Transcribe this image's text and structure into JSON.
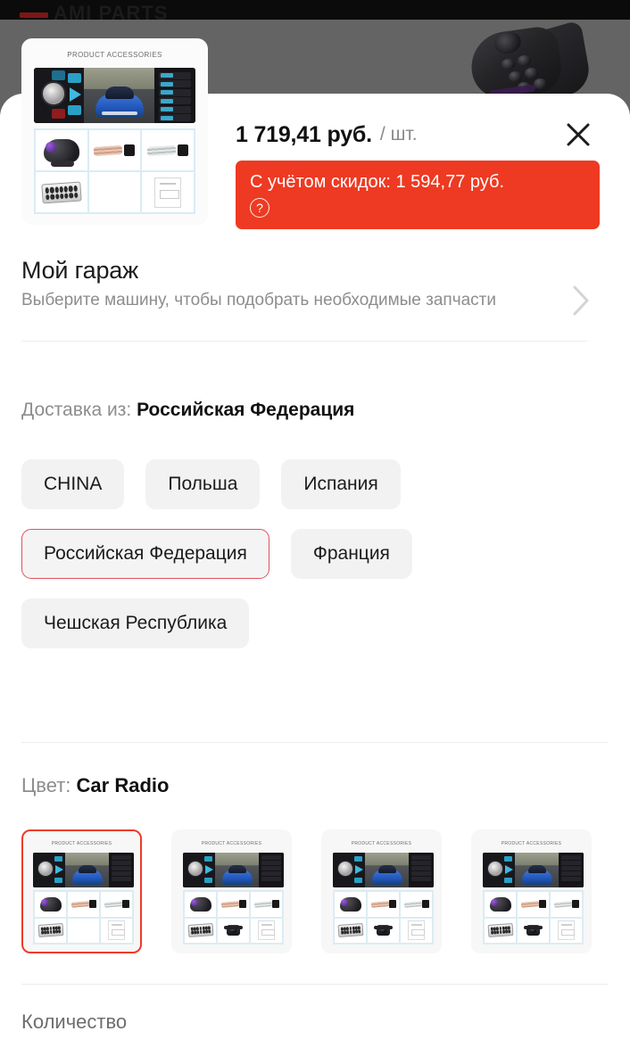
{
  "background": {
    "site_logo": "AMI PARTS",
    "behind_product": "steering-wheel-remote-photo"
  },
  "modal": {
    "price": {
      "amount": "1 719,41 руб.",
      "unit": "/ шт."
    },
    "discount": {
      "text": "С учётом скидок: 1 594,77 руб.",
      "help_icon": "?",
      "color": "#ee3a22"
    },
    "close_icon": "close-icon",
    "product_image_caption": "PRODUCT ACCESSORIES"
  },
  "garage": {
    "title": "Мой гараж",
    "subtitle": "Выберите машину, чтобы подобрать необходимые запчасти",
    "chevron_icon": "chevron-right-icon"
  },
  "delivery": {
    "label": "Доставка из:",
    "selected": "Российская Федерация",
    "options": [
      {
        "label": "CHINA",
        "selected": false
      },
      {
        "label": "Польша",
        "selected": false
      },
      {
        "label": "Испания",
        "selected": false
      },
      {
        "label": "Российская Федерация",
        "selected": true
      },
      {
        "label": "Франция",
        "selected": false
      },
      {
        "label": "Чешская Республика",
        "selected": false
      }
    ],
    "selected_border_color": "#e35060"
  },
  "color": {
    "label": "Цвет:",
    "selected": "Car Radio",
    "variants": [
      {
        "caption": "PRODUCT ACCESSORIES",
        "selected": true,
        "extra": "none"
      },
      {
        "caption": "PRODUCT ACCESSORIES",
        "selected": false,
        "extra": "camera-small"
      },
      {
        "caption": "PRODUCT ACCESSORIES",
        "selected": false,
        "extra": "camera-bracket"
      },
      {
        "caption": "PRODUCT ACCESSORIES",
        "selected": false,
        "extra": "camera-round"
      }
    ]
  },
  "quantity": {
    "label": "Количество"
  }
}
